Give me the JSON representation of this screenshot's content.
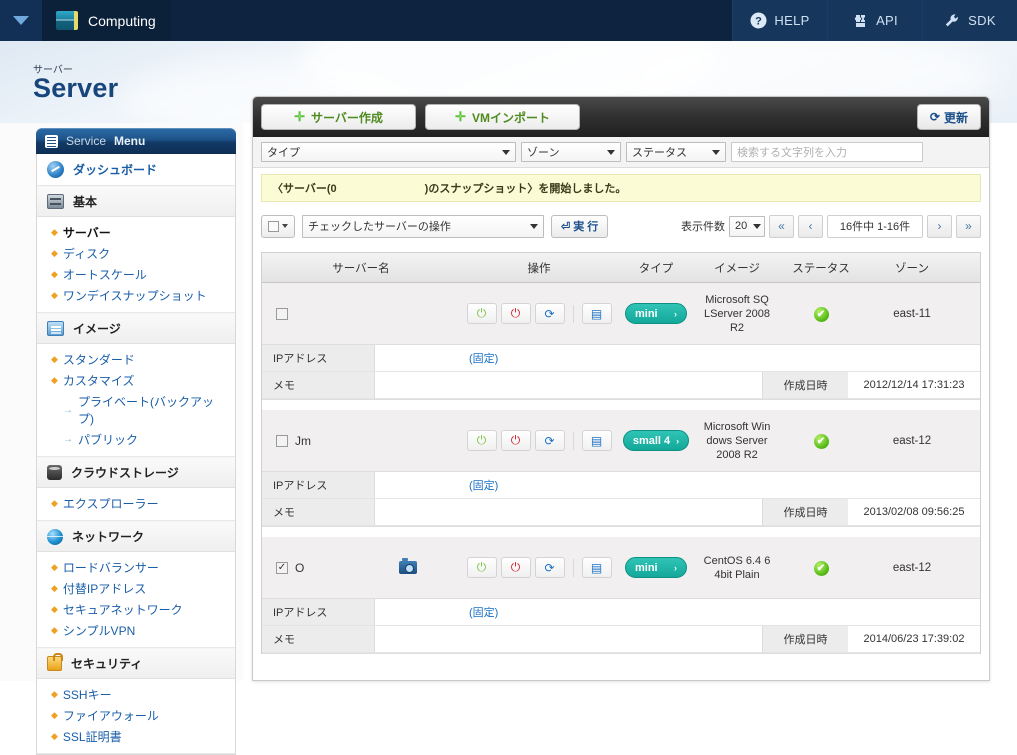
{
  "topbar": {
    "chevron_icon": "chevron-down-icon",
    "brand_logo_icon": "computing-logo-icon",
    "brand_title": "Computing",
    "nav": [
      {
        "label": "HELP",
        "icon": "help-circle-icon"
      },
      {
        "label": "API",
        "icon": "puzzle-piece-icon"
      },
      {
        "label": "SDK",
        "icon": "wrench-icon"
      }
    ]
  },
  "hero": {
    "breadcrumb": "サーバー",
    "title": "Server"
  },
  "sidebar": {
    "header": {
      "icon": "list-icon",
      "text_light": "Service",
      "text_bold": "Menu"
    },
    "dashboard": {
      "icon": "dashboard-globe-icon",
      "label": "ダッシュボード"
    },
    "groups": [
      {
        "icon": "server-stack-icon",
        "label": "基本",
        "links": [
          {
            "label": "サーバー",
            "active": true
          },
          {
            "label": "ディスク",
            "active": false
          },
          {
            "label": "オートスケール",
            "active": false
          },
          {
            "label": "ワンデイスナップショット",
            "active": false
          }
        ],
        "subs": []
      },
      {
        "icon": "monitor-image-icon",
        "label": "イメージ",
        "links": [
          {
            "label": "スタンダード",
            "active": false
          },
          {
            "label": "カスタマイズ",
            "active": false
          }
        ],
        "subs": [
          {
            "label": "プライベート(バックアップ)"
          },
          {
            "label": "パブリック"
          }
        ]
      },
      {
        "icon": "database-icon",
        "label": "クラウドストレージ",
        "links": [
          {
            "label": "エクスプローラー",
            "active": false
          }
        ],
        "subs": []
      },
      {
        "icon": "globe-network-icon",
        "label": "ネットワーク",
        "links": [
          {
            "label": "ロードバランサー",
            "active": false
          },
          {
            "label": "付替IPアドレス",
            "active": false
          },
          {
            "label": "セキュアネットワーク",
            "active": false
          },
          {
            "label": "シンプルVPN",
            "active": false
          }
        ],
        "subs": []
      },
      {
        "icon": "lock-icon",
        "label": "セキュリティ",
        "links": [
          {
            "label": "SSHキー",
            "active": false
          },
          {
            "label": "ファイアウォール",
            "active": false
          },
          {
            "label": "SSL証明書",
            "active": false
          }
        ],
        "subs": []
      }
    ]
  },
  "panel": {
    "toolbar": {
      "create_server": "サーバー作成",
      "vm_import": "VMインポート",
      "plus_glyph": "✛",
      "refresh": "更新",
      "refresh_icon": "refresh-icon"
    },
    "filters": {
      "type": "タイプ",
      "zone": "ゾーン",
      "status": "ステータス",
      "search_placeholder": "検索する文字列を入力"
    },
    "message": {
      "prefix": "〈サーバー(0",
      "suffix": ")のスナップショット〉を開始しました。"
    },
    "actions": {
      "checkbox_dropdown_icon": "checkbox-dropdown-icon",
      "bulk_action": "チェックしたサーバーの操作",
      "execute": "実 行",
      "execute_icon": "execute-arrow-icon"
    },
    "pagination": {
      "label": "表示件数",
      "page_size": "20",
      "first": "«",
      "prev": "‹",
      "range": "16件中 1-16件",
      "next": "›",
      "last": "»"
    },
    "table": {
      "headers": {
        "name": "サーバー名",
        "ops": "操作",
        "type": "タイプ",
        "image": "イメージ",
        "status": "ステータス",
        "zone": "ゾーン"
      },
      "detail_labels": {
        "ip": "IPアドレス",
        "memo": "メモ",
        "created": "作成日時",
        "fixed": "(固定)"
      },
      "op_icons": {
        "power": "power-icon",
        "stop": "power-off-icon",
        "restart": "restart-icon",
        "console": "console-icon"
      },
      "rows": [
        {
          "checked": false,
          "name": "",
          "has_camera": false,
          "type": "mini",
          "type_arrow": "›",
          "image_lines": [
            "Microsoft SQ",
            "LServer 2008",
            "R2"
          ],
          "status_icon": "status-ok-icon",
          "zone": "east-11",
          "ip": "",
          "memo": "",
          "created": "2012/12/14 17:31:23"
        },
        {
          "checked": false,
          "name": "Jm",
          "has_camera": false,
          "type": "small 4",
          "type_arrow": "›",
          "image_lines": [
            "Microsoft Win",
            "dows Server",
            "2008 R2"
          ],
          "status_icon": "status-ok-icon",
          "zone": "east-12",
          "ip": "",
          "memo": "",
          "created": "2013/02/08 09:56:25"
        },
        {
          "checked": true,
          "name": "O",
          "has_camera": true,
          "camera_icon": "camera-icon",
          "type": "mini",
          "type_arrow": "›",
          "image_lines": [
            "CentOS 6.4 6",
            "4bit Plain"
          ],
          "status_icon": "status-ok-icon",
          "zone": "east-12",
          "ip": "",
          "memo": "",
          "created": "2014/06/23 17:39:02"
        }
      ]
    }
  },
  "colors": {
    "topbar_bg": "#0d2340",
    "title_blue": "#17457c",
    "link_blue": "#1a5ea8",
    "accent_teal": "#13a899",
    "status_green": "#55bb16",
    "msg_yellow": "#fbfbd6",
    "create_green": "#4f8b1f"
  }
}
